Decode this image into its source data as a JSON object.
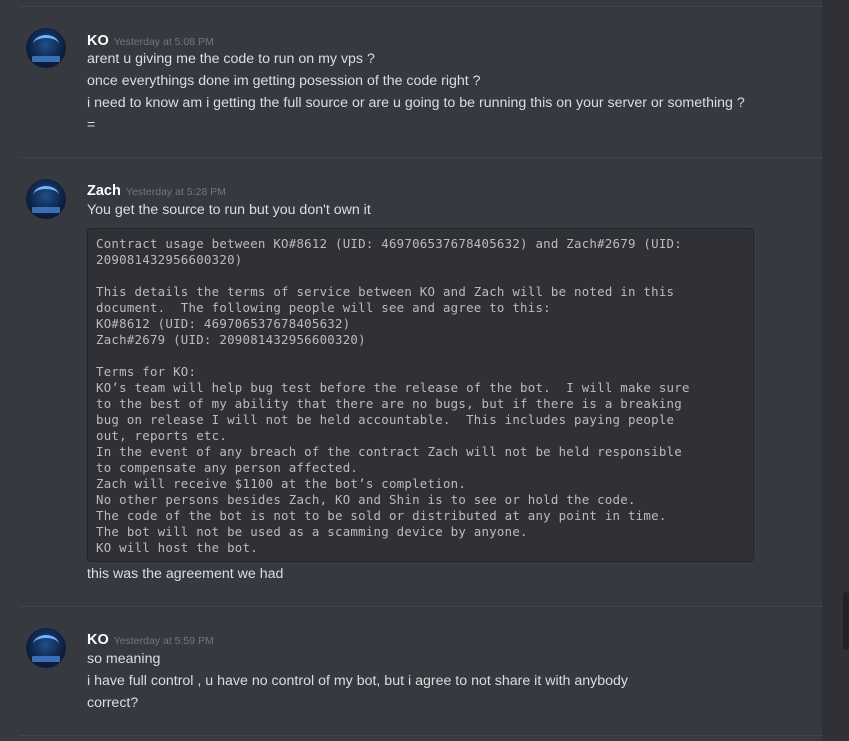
{
  "messages": [
    {
      "author": "KO",
      "timestamp": "Yesterday at 5:08 PM",
      "lines": [
        "arent u giving me the code to run on my vps  ?",
        "once everythings done im getting posession of the code right ?",
        "i need to know am i getting the full source  or are u going to be running this on your server or something ?",
        "="
      ]
    },
    {
      "author": "Zach",
      "timestamp": "Yesterday at 5:28 PM",
      "lines": [
        "You get the source to run but you don't own it"
      ],
      "code": [
        "Contract usage between KO#8612 (UID: 469706537678405632) and Zach#2679 (UID:",
        "209081432956600320)",
        "",
        "This details the terms of service between KO and Zach will be noted in this",
        "document.  The following people will see and agree to this:",
        "KO#8612 (UID: 469706537678405632)",
        "Zach#2679 (UID: 209081432956600320)",
        "",
        "Terms for KO:",
        "KO’s team will help bug test before the release of the bot.  I will make sure",
        "to the best of my ability that there are no bugs, but if there is a breaking",
        "bug on release I will not be held accountable.  This includes paying people",
        "out, reports etc.",
        "In the event of any breach of the contract Zach will not be held responsible",
        "to compensate any person affected.",
        "Zach will receive $1100 at the bot’s completion.",
        "No other persons besides Zach, KO and Shin is to see or hold the code.",
        "The code of the bot is not to be sold or distributed at any point in time.",
        "The bot will not be used as a scamming device by anyone.",
        "KO will host the bot."
      ],
      "after": [
        "this was the agreement we had"
      ]
    },
    {
      "author": "KO",
      "timestamp": "Yesterday at 5:59 PM",
      "lines": [
        "so meaning",
        "i have full control , u have no control of my bot, but i agree to not share it with anybody",
        "correct?"
      ]
    }
  ]
}
